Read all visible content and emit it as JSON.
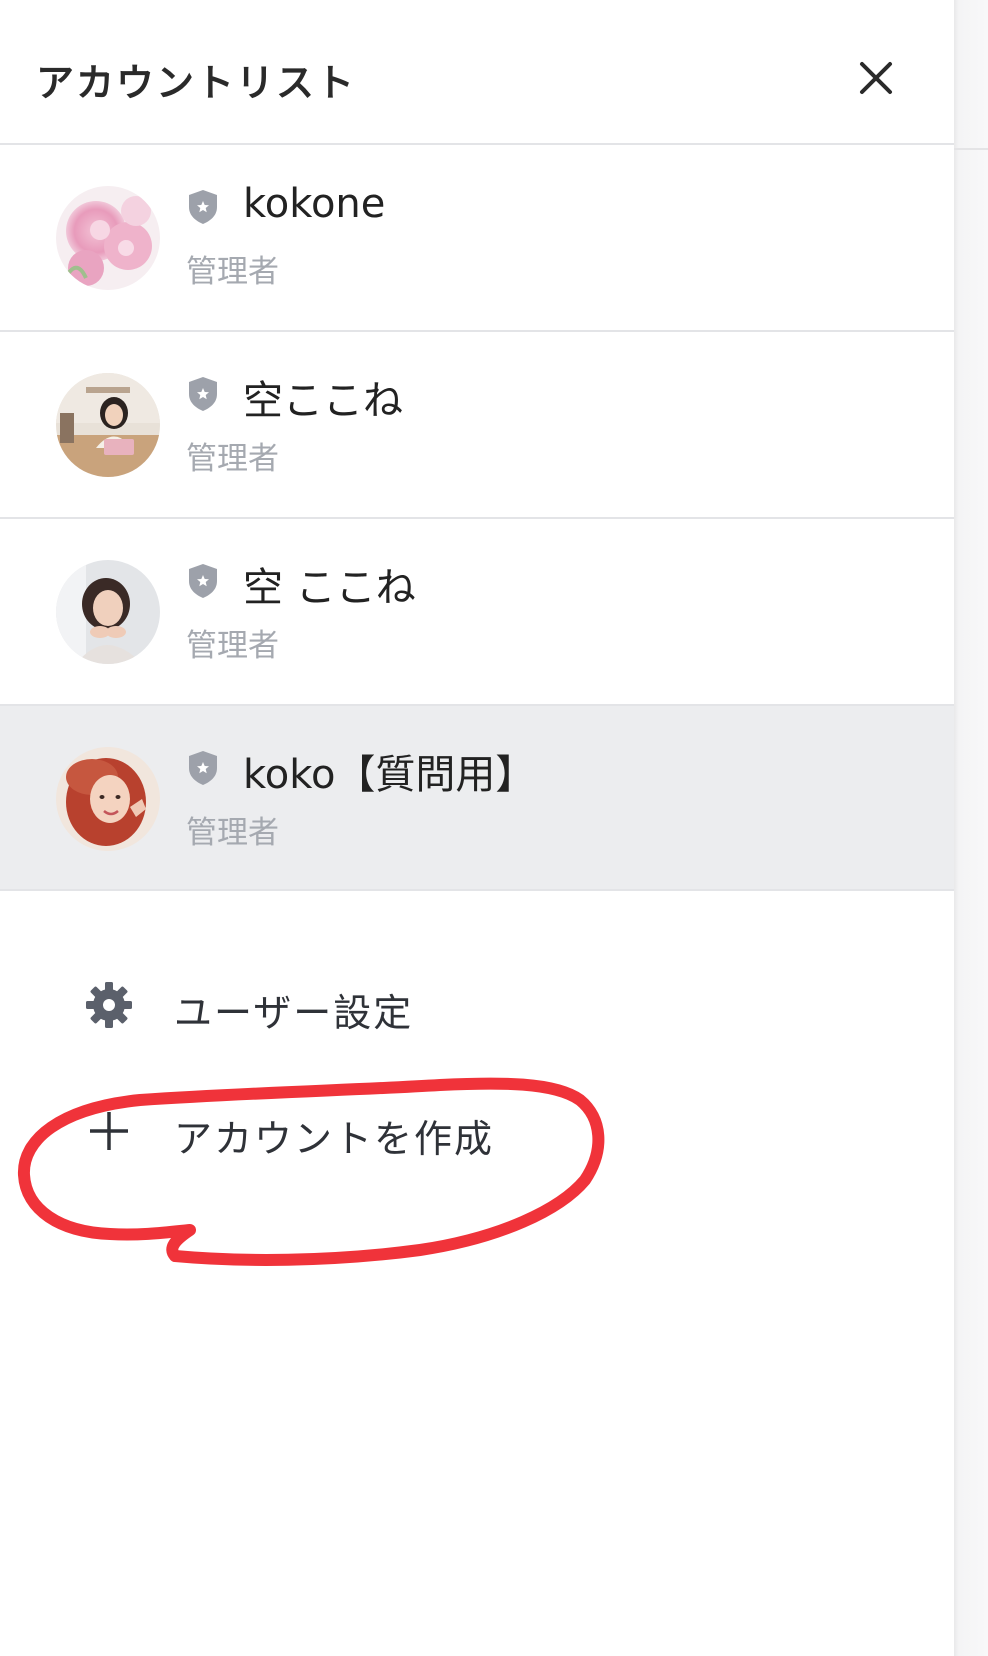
{
  "header": {
    "title": "アカウントリスト",
    "close_icon": "close-icon"
  },
  "accounts": [
    {
      "name": "kokone",
      "role": "管理者",
      "badge_icon": "shield-star-icon",
      "avatar": "pink-flowers-photo",
      "selected": false
    },
    {
      "name": "空ここね",
      "role": "管理者",
      "badge_icon": "shield-star-icon",
      "avatar": "woman-at-laptop-photo",
      "selected": false
    },
    {
      "name": "空 ここね",
      "role": "管理者",
      "badge_icon": "shield-star-icon",
      "avatar": "woman-portrait-photo",
      "selected": false
    },
    {
      "name": "koko【質問用】",
      "role": "管理者",
      "badge_icon": "shield-star-icon",
      "avatar": "red-hair-woman-photo",
      "selected": true
    }
  ],
  "menu": {
    "user_settings": {
      "label": "ユーザー設定",
      "icon": "gear-icon"
    },
    "create_account": {
      "label": "アカウントを作成",
      "icon": "plus-icon"
    }
  },
  "colors": {
    "selected_row_bg": "#ecedef",
    "divider": "#e3e4e7",
    "role_text": "#a5a9b0",
    "icon_gray": "#8e929b",
    "annotation_red": "#f0333a"
  }
}
